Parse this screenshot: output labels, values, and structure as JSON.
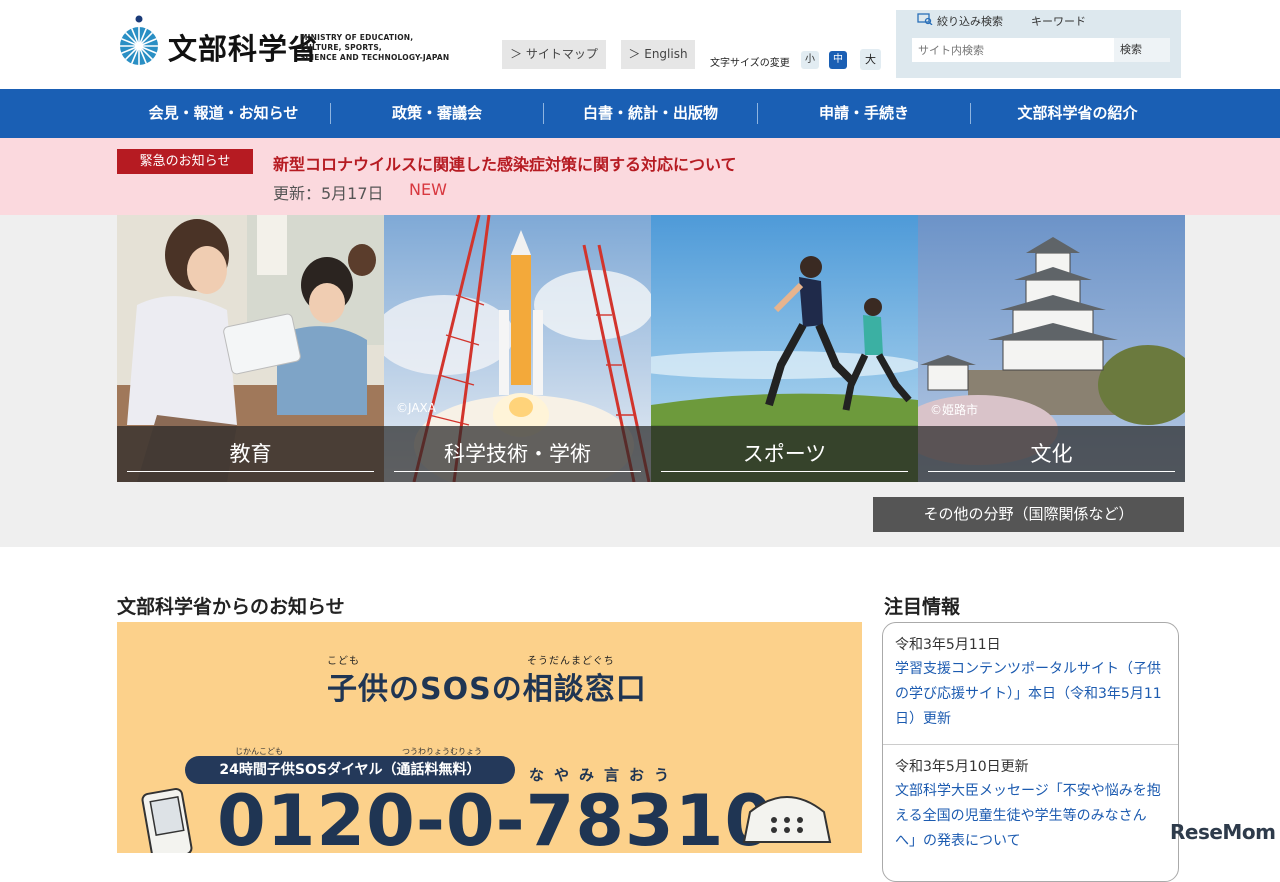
{
  "header": {
    "logo_jp": "文部科学省",
    "logo_en": "MINISTRY OF EDUCATION,\nCULTURE, SPORTS,\nSCIENCE AND TECHNOLOGY-JAPAN",
    "sitemap": "＞ サイトマップ",
    "english": "＞ English",
    "font_size_label": "文字サイズの変更",
    "font_sizes": [
      "小",
      "中",
      "大"
    ],
    "search_tab_filter": "絞り込み検索",
    "search_tab_keyword": "キーワード",
    "search_placeholder": "サイト内検索",
    "search_button": "検索"
  },
  "nav": [
    "会見・報道・お知らせ",
    "政策・審議会",
    "白書・統計・出版物",
    "申請・手続き",
    "文部科学省の紹介"
  ],
  "emergency": {
    "badge": "緊急のお知らせ",
    "title": "新型コロナウイルスに関連した感染症対策に関する対応について",
    "update": "更新：5月17日",
    "new": "NEW"
  },
  "tiles": [
    {
      "label": "教育",
      "credit": ""
    },
    {
      "label": "科学技術・学術",
      "credit": "©JAXA"
    },
    {
      "label": "スポーツ",
      "credit": ""
    },
    {
      "label": "文化",
      "credit": "©姫路市"
    }
  ],
  "other_fields": "その他の分野（国際関係など）",
  "news": {
    "title": "文部科学省からのお知らせ",
    "banner": {
      "ruby_kodomo": "こども",
      "ruby_soudan": "そうだんまどぐち",
      "title": "子供のSOSの相談窓口",
      "ruby_jikan": "じかんこども",
      "ruby_tsuwa": "つうわりょうむりょう",
      "pill": "24時間子供SOSダイヤル（通話料無料）",
      "nayami": "なやみ言おう",
      "phone": "0120-0-78310"
    }
  },
  "attention": {
    "title": "注目情報",
    "items": [
      {
        "date": "令和3年5月11日",
        "text": "学習支援コンテンツポータルサイト（子供の学び応援サイト）」本日（令和3年5月11日）更新"
      },
      {
        "date": "令和3年5月10日更新",
        "text": "文部科学大臣メッセージ「不安や悩みを抱える全国の児童生徒や学生等のみなさんへ」の発表について"
      }
    ]
  },
  "watermark": "ReseMom",
  "colors": {
    "nav_blue": "#1a5fb4",
    "emergency_red": "#b61b22",
    "emergency_bg": "#fbd9de",
    "banner_yellow": "#fcd18b",
    "link_blue": "#1c5bb0"
  }
}
